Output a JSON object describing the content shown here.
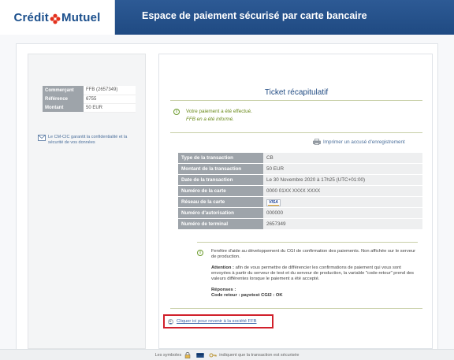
{
  "brand": {
    "logo_left": "Crédit",
    "logo_right": "Mutuel"
  },
  "header": {
    "title": "Espace de paiement sécurisé par carte bancaire"
  },
  "merchant_info": [
    {
      "label": "Commerçant",
      "value": "FFB (2657349)"
    },
    {
      "label": "Référence",
      "value": "6755"
    },
    {
      "label": "Montant",
      "value": "50 EUR"
    }
  ],
  "guarantee_text": "Le CM-CIC garantit la confidentialité et la sécurité de vos données",
  "ticket": {
    "title": "Ticket récapitulatif",
    "success_line1": "Votre paiement a été effectué.",
    "success_line2": "FFB en a été informé.",
    "print_label": "Imprimer un accusé d'enregistrement"
  },
  "transaction": [
    {
      "label": "Type de la transaction",
      "value": "CB"
    },
    {
      "label": "Montant de la transaction",
      "value": "50 EUR"
    },
    {
      "label": "Date de la transaction",
      "value": "Le 30 Novembre 2020 à 17h25 (UTC+01:00)"
    },
    {
      "label": "Numéro de la carte",
      "value": "0000 01XX XXXX XXXX"
    },
    {
      "label": "Réseau de la carte",
      "value": ""
    },
    {
      "label": "Numéro d'autorisation",
      "value": "000000"
    },
    {
      "label": "Numéro de terminal",
      "value": "2657349"
    }
  ],
  "visa_label": "VISA",
  "help": {
    "intro": "Fenêtre d'aide au développement du CGI de confirmation des paiements. Non affichée sur le serveur de production.",
    "attention_label": "Attention :",
    "attention_text": "afin de vous permettre de différencier les confirmations de paiement qui vous sont envoyées à partir du serveur de test et du serveur de production, la variable \"code-retour\" prend des valeurs différentes lorsque le paiement a été accepté.",
    "response_label": "Réponses :",
    "response_text": "Code retour : payetest CGI2 : OK"
  },
  "return_link": "Cliquer ici pour revenir à la société FFB",
  "footer": {
    "text_before": "Les symboles",
    "text_after": "indiquent que la transaction est sécurisée"
  }
}
